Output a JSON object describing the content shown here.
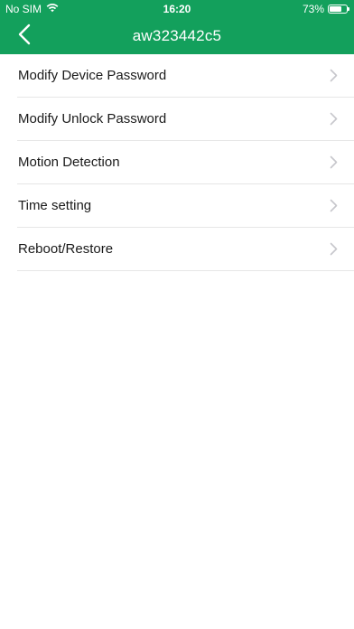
{
  "status_bar": {
    "carrier": "No SIM",
    "time": "16:20",
    "battery_percent": "73%",
    "battery_level": 0.73,
    "wifi_icon": "wifi-icon"
  },
  "nav": {
    "title": "aw323442c5",
    "back_icon": "chevron-left-icon"
  },
  "colors": {
    "header_bg": "#13a05c",
    "divider": "#e6e6e6",
    "chevron": "#c7c7cc"
  },
  "menu": {
    "items": [
      {
        "label": "Modify Device Password"
      },
      {
        "label": "Modify Unlock Password"
      },
      {
        "label": "Motion Detection"
      },
      {
        "label": "Time setting"
      },
      {
        "label": "Reboot/Restore"
      }
    ]
  }
}
